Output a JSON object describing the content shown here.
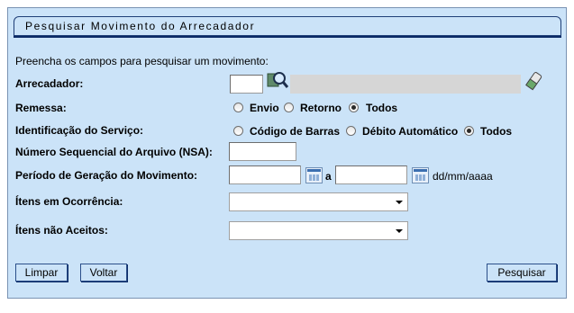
{
  "panel": {
    "title": "Pesquisar Movimento do Arrecadador",
    "instructions": "Preencha os campos para pesquisar um movimento:"
  },
  "form": {
    "arrecadador": {
      "label": "Arrecadador:",
      "code_value": "",
      "name_value": ""
    },
    "remessa": {
      "label": "Remessa:",
      "options": [
        "Envio",
        "Retorno",
        "Todos"
      ],
      "selected": "Todos"
    },
    "identificacao": {
      "label": "Identificação do Serviço:",
      "options": [
        "Código de Barras",
        "Débito Automático",
        "Todos"
      ],
      "selected": "Todos"
    },
    "nsa": {
      "label": "Número Sequencial do Arquivo (NSA):",
      "value": ""
    },
    "periodo": {
      "label": "Período de Geração do Movimento:",
      "from_value": "",
      "to_value": "",
      "separator": "a",
      "format_hint": "dd/mm/aaaa"
    },
    "itens_ocorrencia": {
      "label": "Ítens em Ocorrência:",
      "selected": ""
    },
    "itens_nao_aceitos": {
      "label": "Ítens não Aceitos:",
      "selected": ""
    }
  },
  "buttons": {
    "limpar": "Limpar",
    "voltar": "Voltar",
    "pesquisar": "Pesquisar"
  },
  "icons": {
    "search": "magnifier-icon",
    "eraser": "eraser-icon",
    "calendar": "calendar-icon"
  },
  "colors": {
    "panel_bg": "#cbe3f8",
    "title_border": "#1f3f77",
    "button_border": "#2b4f8a"
  }
}
